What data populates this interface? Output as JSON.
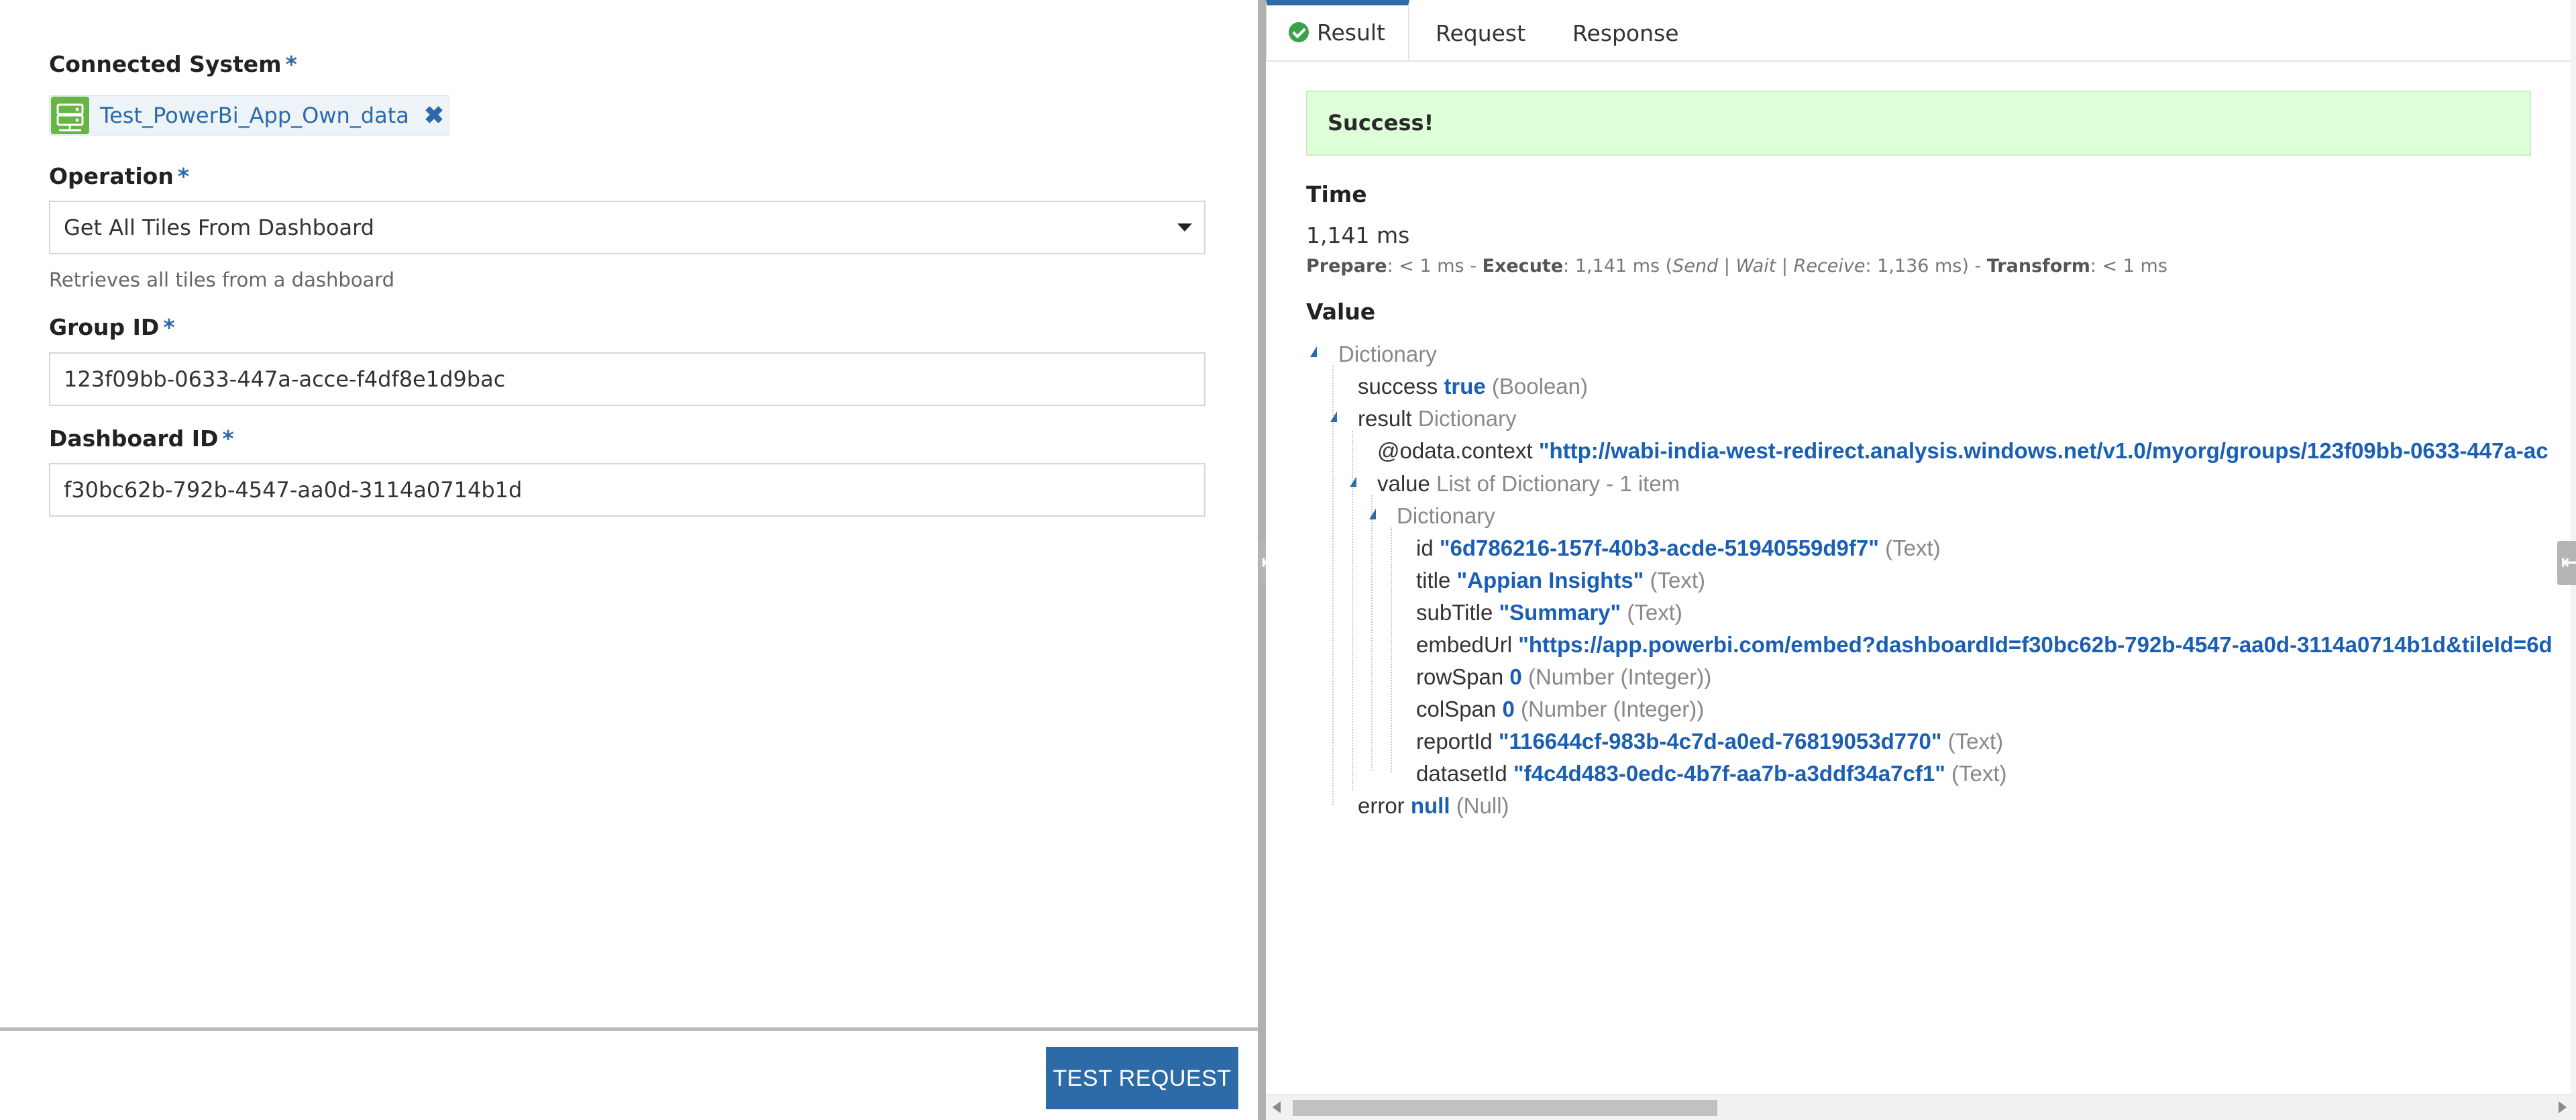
{
  "form": {
    "connected_system_label": "Connected System",
    "connected_system_value": "Test_PowerBi_App_Own_data",
    "operation_label": "Operation",
    "operation_value": "Get All Tiles From Dashboard",
    "operation_help": "Retrieves all tiles from a dashboard",
    "group_id_label": "Group ID",
    "group_id_value": "123f09bb-0633-447a-acce-f4df8e1d9bac",
    "dashboard_id_label": "Dashboard ID",
    "dashboard_id_value": "f30bc62b-792b-4547-aa0d-3114a0714b1d",
    "required_mark": "*",
    "test_button": "TEST REQUEST"
  },
  "tabs": {
    "result": "Result",
    "request": "Request",
    "response": "Response",
    "active": "Result"
  },
  "result": {
    "banner": "Success!",
    "time_heading": "Time",
    "time_value": "1,141 ms",
    "breakdown": {
      "prepare_label": "Prepare",
      "prepare_value": ": < 1 ms - ",
      "execute_label": "Execute",
      "execute_value": ": 1,141 ms (",
      "send_wait_receive": "Send | Wait | Receive",
      "swr_value": ": 1,136 ms) - ",
      "transform_label": "Transform",
      "transform_value": ": < 1 ms"
    },
    "value_heading": "Value",
    "tree": {
      "root_type": "Dictionary",
      "success_key": "success",
      "success_value": "true",
      "success_type": "(Boolean)",
      "result_key": "result",
      "result_type": "Dictionary",
      "odata_key": "@odata.context",
      "odata_value": "\"http://wabi-india-west-redirect.analysis.windows.net/v1.0/myorg/groups/123f09bb-0633-447a-ac",
      "value_key": "value",
      "value_type": "List of Dictionary - 1 item",
      "item_type": "Dictionary",
      "fields": [
        {
          "key": "id",
          "value": "\"6d786216-157f-40b3-acde-51940559d9f7\"",
          "type": "(Text)"
        },
        {
          "key": "title",
          "value": "\"Appian Insights\"",
          "type": "(Text)"
        },
        {
          "key": "subTitle",
          "value": "\"Summary\"",
          "type": "(Text)"
        },
        {
          "key": "embedUrl",
          "value": "\"https://app.powerbi.com/embed?dashboardId=f30bc62b-792b-4547-aa0d-3114a0714b1d&tileId=6d",
          "type": ""
        },
        {
          "key": "rowSpan",
          "value": "0",
          "type": "(Number (Integer))"
        },
        {
          "key": "colSpan",
          "value": "0",
          "type": "(Number (Integer))"
        },
        {
          "key": "reportId",
          "value": "\"116644cf-983b-4c7d-a0ed-76819053d770\"",
          "type": "(Text)"
        },
        {
          "key": "datasetId",
          "value": "\"f4c4d483-0edc-4b7f-aa7b-a3ddf34a7cf1\"",
          "type": "(Text)"
        }
      ],
      "error_key": "error",
      "error_value": "null",
      "error_type": "(Null)"
    }
  },
  "colors": {
    "accent": "#2d6aa8",
    "success_bg": "#dfffd8",
    "success_icon": "#3aa34a",
    "chip_icon": "#66b545"
  },
  "icons": {
    "connected_system": "server-icon",
    "remove": "close-icon",
    "dropdown": "caret-down-icon",
    "success": "check-circle-icon",
    "tree_toggle": "expanded-triangle-icon",
    "collapse": "arrow-left-icon"
  }
}
